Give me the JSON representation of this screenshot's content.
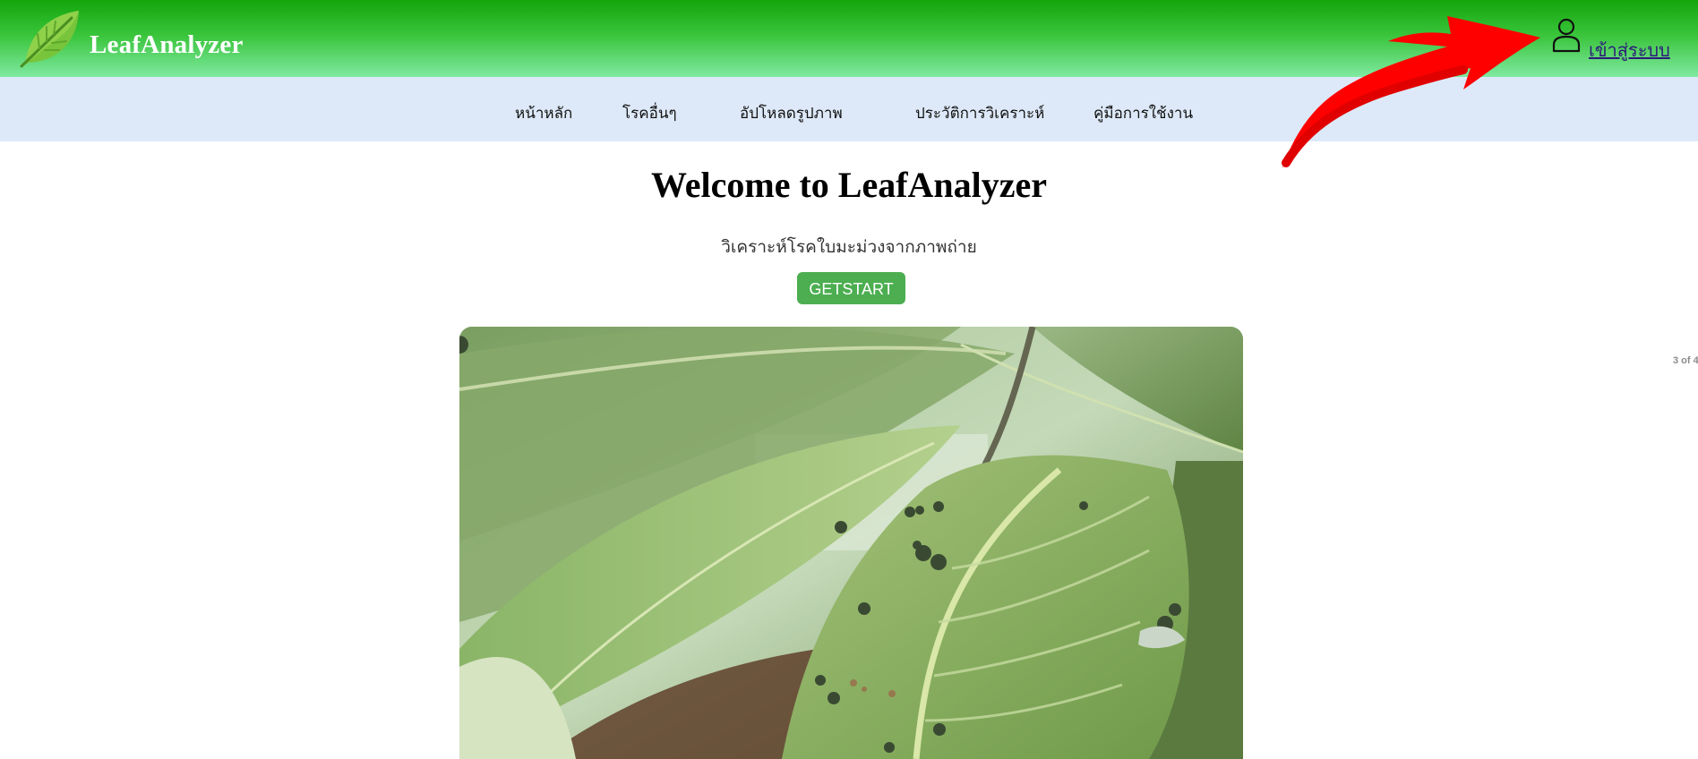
{
  "header": {
    "brand": "LeafAnalyzer",
    "logo_icon": "leaf-icon",
    "user_icon": "user-icon",
    "login_label": "เข้าสู่ระบบ",
    "colors": {
      "gradient_top": "#14a50b",
      "gradient_bottom": "#7fe9a1"
    }
  },
  "nav": {
    "items": [
      {
        "label": "หน้าหลัก"
      },
      {
        "label": "โรคอื่นๆ"
      },
      {
        "label": "อัปโหลดรูปภาพ"
      },
      {
        "label": "ประวัติการวิเคราะห์"
      },
      {
        "label": "คู่มือการใช้งาน"
      }
    ],
    "background": "#dde9f8"
  },
  "annotation": {
    "icon": "red-arrow-icon",
    "color": "#ff0000"
  },
  "hero": {
    "title": "Welcome to LeafAnalyzer",
    "subtitle": "วิเคราะห์โรคใบมะม่วงจากภาพถ่าย",
    "cta_label": "GETSTART",
    "cta_color": "#4cae50"
  },
  "slideshow": {
    "image": "mango-leaf-disease-photo",
    "counter": "3 of 4"
  }
}
